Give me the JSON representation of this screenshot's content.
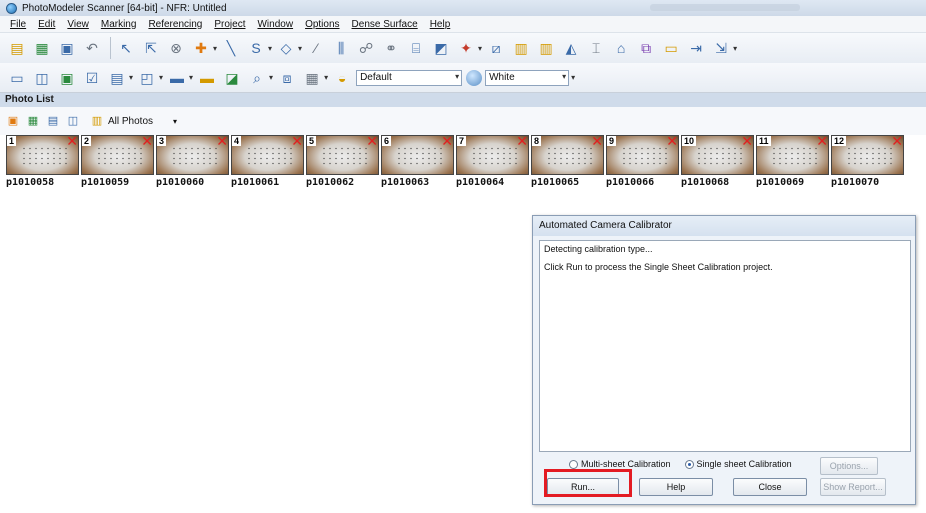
{
  "window": {
    "title": "PhotoModeler Scanner [64-bit] - NFR: Untitled"
  },
  "menu": [
    "File",
    "Edit",
    "View",
    "Marking",
    "Referencing",
    "Project",
    "Window",
    "Options",
    "Dense Surface",
    "Help"
  ],
  "toolbar2": {
    "mode_combo": "Default",
    "color_combo": "White"
  },
  "photo_list": {
    "title": "Photo List",
    "filter": "All Photos",
    "photos": [
      {
        "num": "1",
        "name": "p1010058"
      },
      {
        "num": "2",
        "name": "p1010059"
      },
      {
        "num": "3",
        "name": "p1010060"
      },
      {
        "num": "4",
        "name": "p1010061"
      },
      {
        "num": "5",
        "name": "p1010062"
      },
      {
        "num": "6",
        "name": "p1010063"
      },
      {
        "num": "7",
        "name": "p1010064"
      },
      {
        "num": "8",
        "name": "p1010065"
      },
      {
        "num": "9",
        "name": "p1010066"
      },
      {
        "num": "10",
        "name": "p1010068"
      },
      {
        "num": "11",
        "name": "p1010069"
      },
      {
        "num": "12",
        "name": "p1010070"
      }
    ]
  },
  "dialog": {
    "title": "Automated Camera Calibrator",
    "log": [
      "Detecting calibration type...",
      "Click Run to process the Single Sheet Calibration project."
    ],
    "radio_multi": "Multi-sheet Calibration",
    "radio_single": "Single sheet Calibration",
    "options_label": "Options...",
    "run_label": "Run...",
    "help_label": "Help",
    "close_label": "Close",
    "report_label": "Show Report..."
  },
  "colors": {
    "highlight": "#e31b23",
    "panel_header": "#cfdbea"
  }
}
